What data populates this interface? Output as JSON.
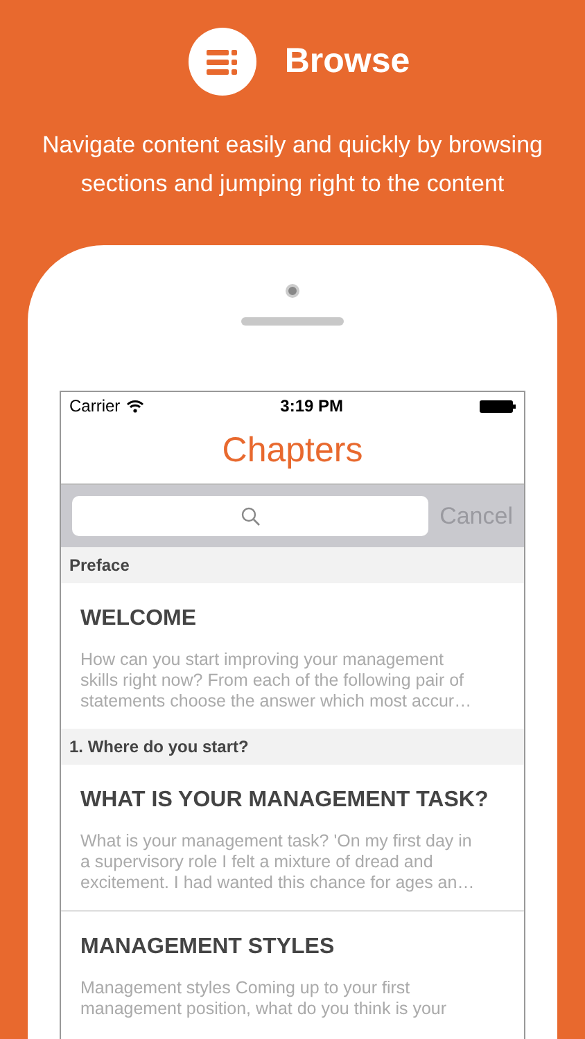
{
  "header": {
    "title": "Browse",
    "subtitle": "Navigate content easily and quickly by browsing sections and jumping right to the content"
  },
  "status_bar": {
    "carrier": "Carrier",
    "time": "3:19 PM"
  },
  "nav": {
    "title": "Chapters"
  },
  "search": {
    "cancel": "Cancel"
  },
  "sections": [
    {
      "title": "Preface",
      "rows": [
        {
          "title": "WELCOME",
          "lines": [
            "How can you start improving your management",
            "skills right now? From each of the following pair of",
            "statements choose the answer which most accur…"
          ]
        }
      ]
    },
    {
      "title": "1. Where do you start?",
      "rows": [
        {
          "title": "WHAT IS YOUR MANAGEMENT TASK?",
          "lines": [
            "What is your management task? 'On my first day in",
            "a supervisory role I felt a mixture of dread and",
            "excitement. I had wanted this chance for ages an…"
          ]
        },
        {
          "title": "MANAGEMENT STYLES",
          "lines": [
            "Management styles Coming up to your first",
            "management position, what do you think is your"
          ]
        }
      ]
    }
  ]
}
